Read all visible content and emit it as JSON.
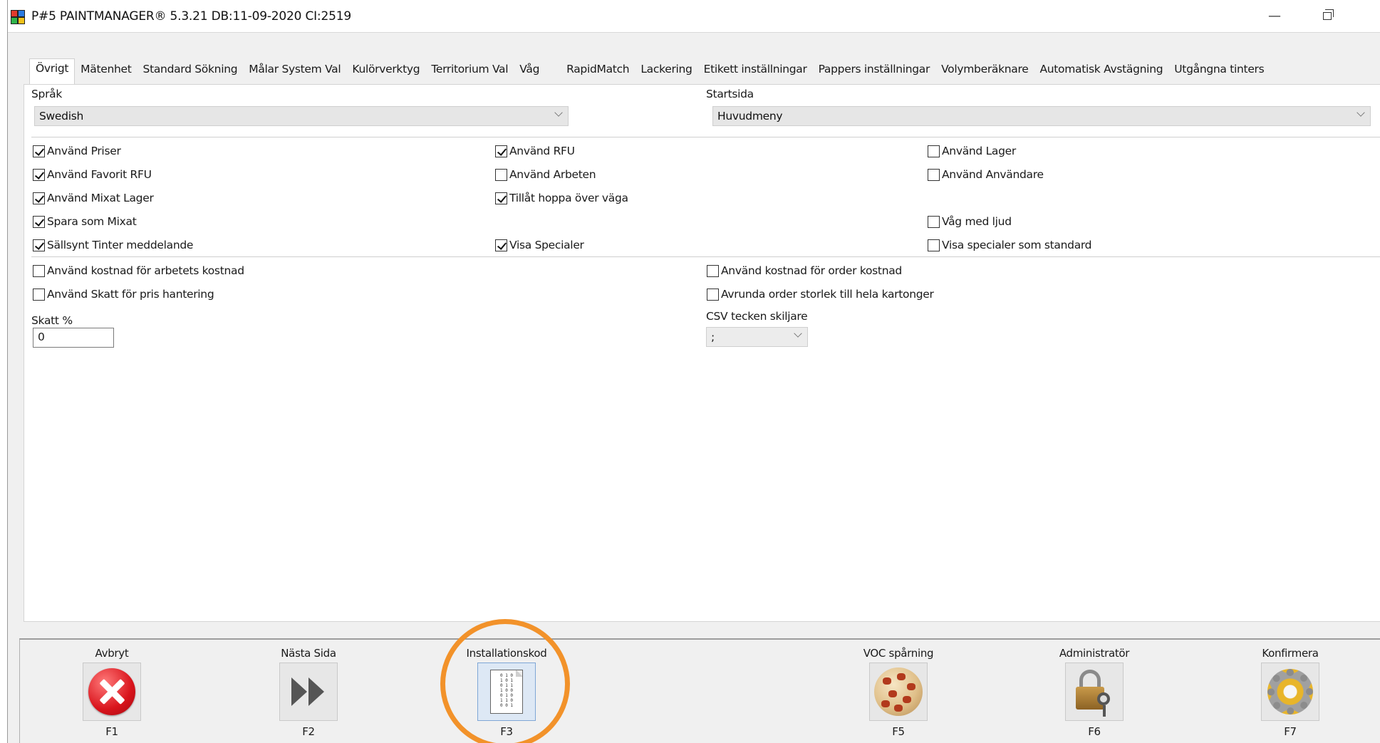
{
  "window": {
    "title": "P#5 PAINTMANAGER® 5.3.21 DB:11-09-2020 CI:2519",
    "minimize_glyph": "—",
    "restore_glyph": ""
  },
  "tabs": [
    {
      "label": "Övrigt",
      "active": true
    },
    {
      "label": "Mätenhet"
    },
    {
      "label": "Standard Sökning"
    },
    {
      "label": "Målar System Val"
    },
    {
      "label": "Kulörverktyg"
    },
    {
      "label": "Territorium Val"
    },
    {
      "label": "Våg"
    },
    {
      "label": "RapidMatch"
    },
    {
      "label": "Lackering"
    },
    {
      "label": "Etikett inställningar"
    },
    {
      "label": "Pappers inställningar"
    },
    {
      "label": "Volymberäknare"
    },
    {
      "label": "Automatisk Avstägning"
    },
    {
      "label": "Utgångna tinters"
    }
  ],
  "language": {
    "label": "Språk",
    "value": "Swedish"
  },
  "startpage": {
    "label": "Startsida",
    "value": "Huvudmeny"
  },
  "checkboxes": {
    "use_prices": {
      "label": "Använd Priser",
      "checked": true
    },
    "use_favorite_rfu": {
      "label": "Använd Favorit RFU",
      "checked": true
    },
    "use_mixed_stock": {
      "label": "Använd Mixat Lager",
      "checked": true
    },
    "save_as_mixed": {
      "label": "Spara som Mixat",
      "checked": true
    },
    "rare_tinter_msg": {
      "label": "Sällsynt Tinter meddelande",
      "checked": true
    },
    "use_rfu": {
      "label": "Använd RFU",
      "checked": true
    },
    "use_jobs": {
      "label": "Använd Arbeten",
      "checked": false
    },
    "allow_skip_weigh": {
      "label": "Tillåt hoppa över väga",
      "checked": true
    },
    "show_specials": {
      "label": "Visa Specialer",
      "checked": true
    },
    "use_stock": {
      "label": "Använd Lager",
      "checked": false
    },
    "use_users": {
      "label": "Använd Användare",
      "checked": false
    },
    "scale_sound": {
      "label": "Våg med ljud",
      "checked": false
    },
    "specials_default": {
      "label": "Visa specialer som standard",
      "checked": false
    },
    "use_cost_job": {
      "label": "Använd kostnad för arbetets kostnad",
      "checked": false
    },
    "use_tax_price": {
      "label": "Använd Skatt för pris hantering",
      "checked": false
    },
    "use_cost_order": {
      "label": "Använd kostnad för order kostnad",
      "checked": false
    },
    "round_order": {
      "label": "Avrunda order storlek till hela kartonger",
      "checked": false
    }
  },
  "tax": {
    "label": "Skatt %",
    "value": "0"
  },
  "csv": {
    "label": "CSV tecken skiljare",
    "value": ";"
  },
  "toolbar": {
    "cancel": {
      "label": "Avbryt",
      "key": "F1",
      "icon": "cancel-icon"
    },
    "next": {
      "label": "Nästa Sida",
      "key": "F2",
      "icon": "next-page-icon"
    },
    "install": {
      "label": "Installationskod",
      "key": "F3",
      "icon": "document-code-icon"
    },
    "voc": {
      "label": "VOC spårning",
      "key": "F5",
      "icon": "voc-icon"
    },
    "admin": {
      "label": "Administratör",
      "key": "F6",
      "icon": "lock-key-icon"
    },
    "confirm": {
      "label": "Konfirmera",
      "key": "F7",
      "icon": "gear-icon"
    }
  },
  "colors": {
    "highlight_ring": "#f2922a",
    "cancel_red": "#d9141c"
  }
}
